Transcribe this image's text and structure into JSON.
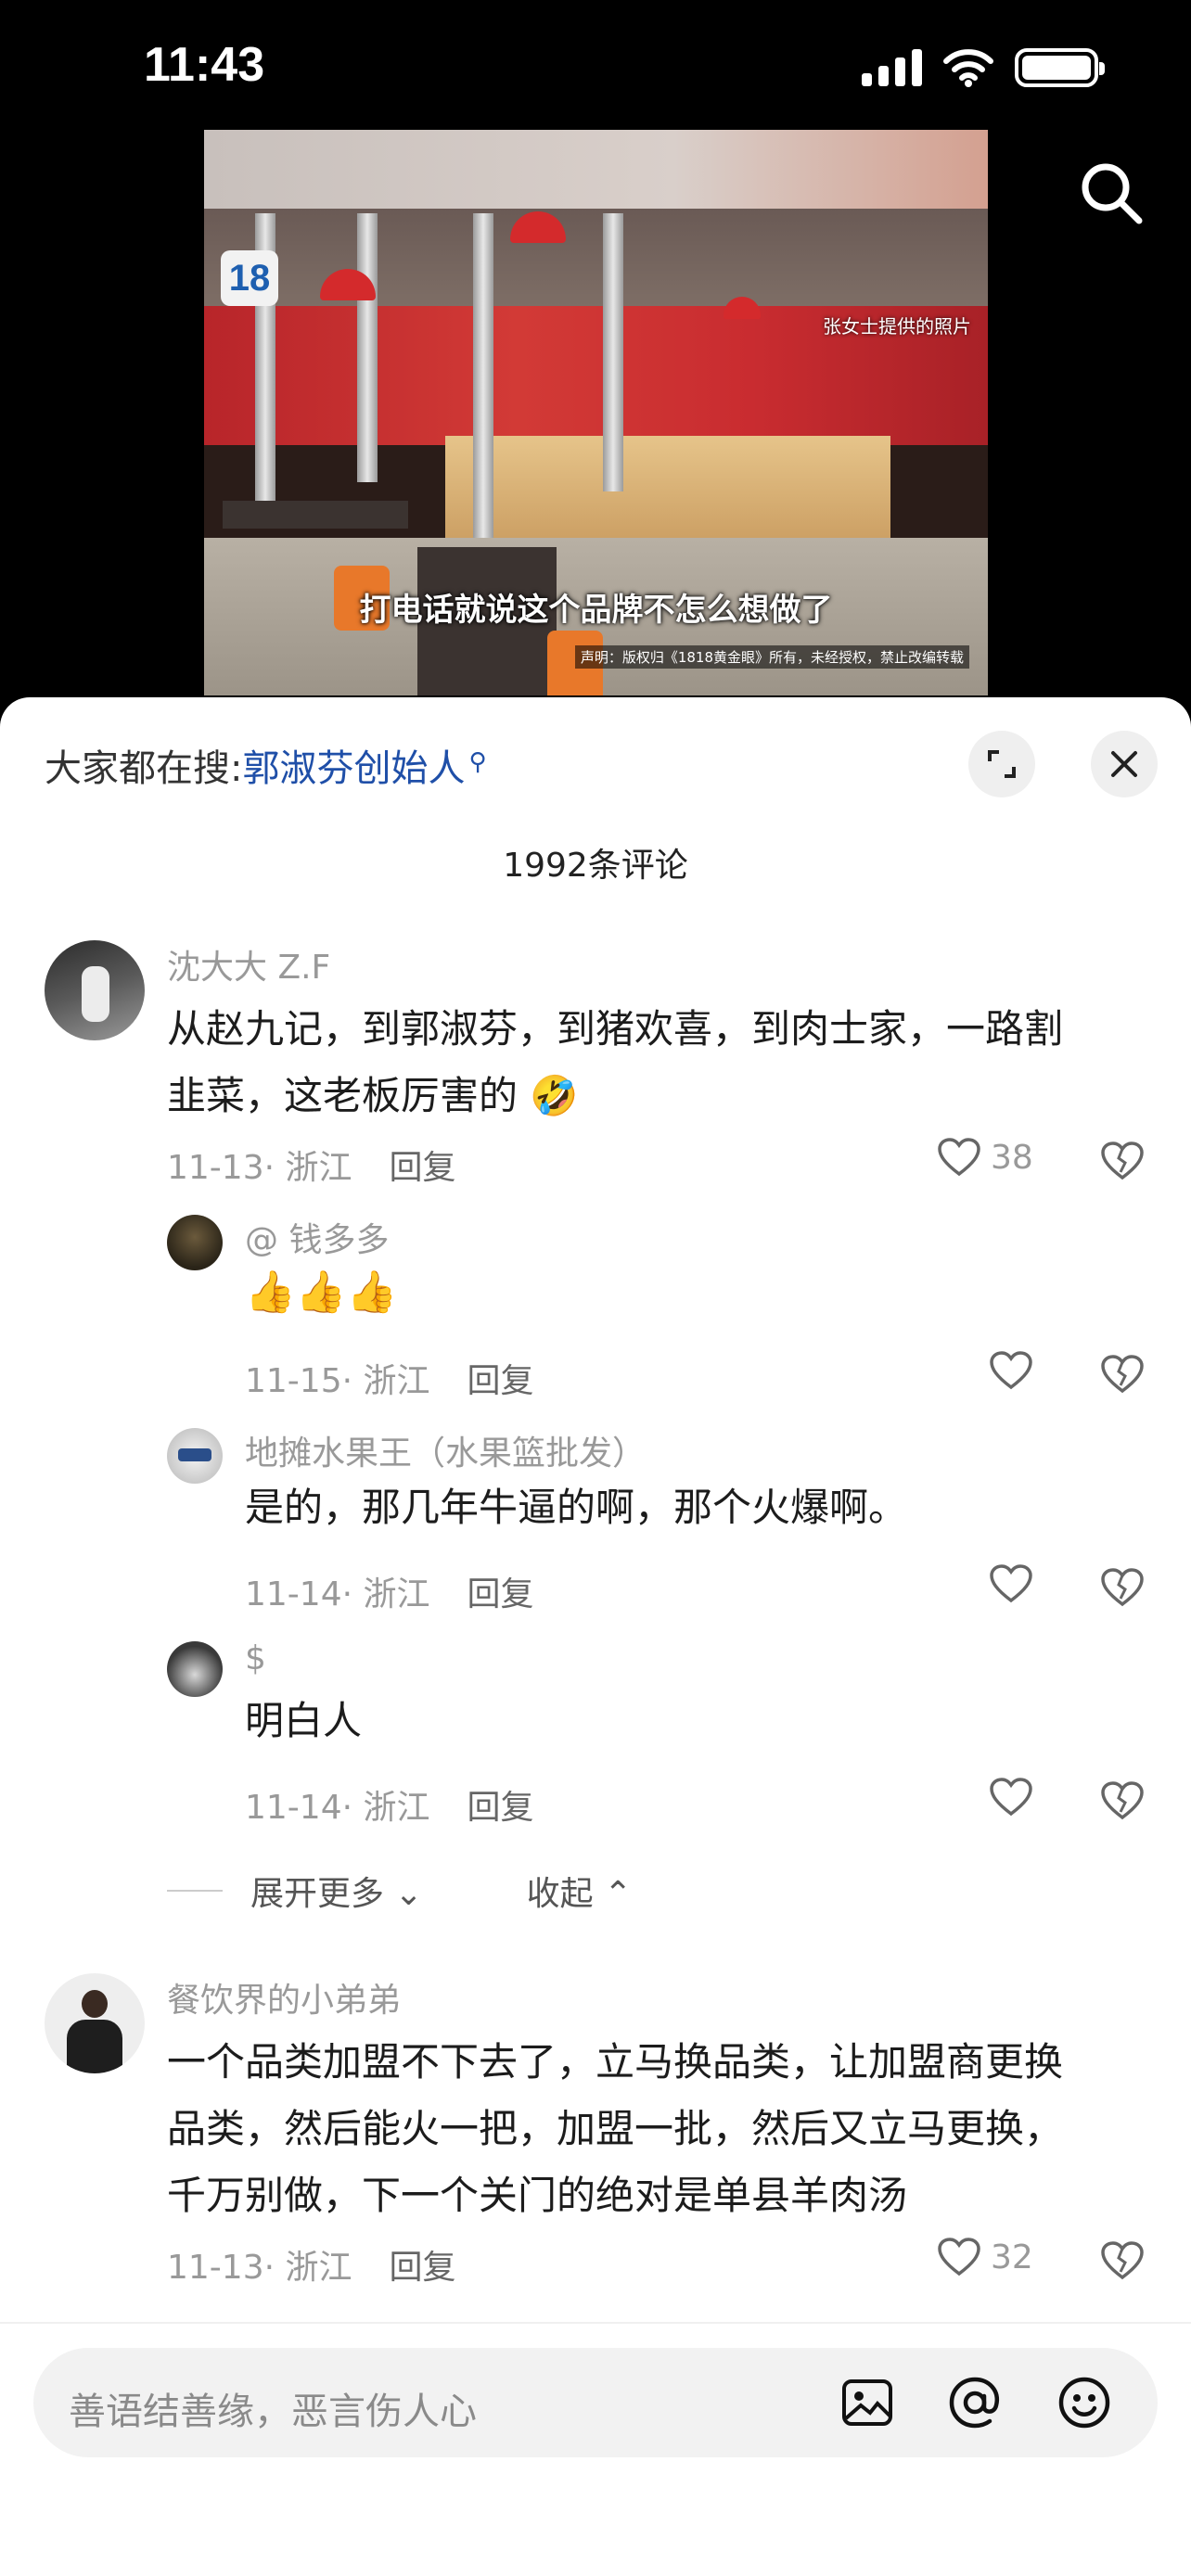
{
  "status_bar": {
    "time": "11:43"
  },
  "video": {
    "channel_logo": "18",
    "photo_credit": "张女士提供的照片",
    "subtitle": "打电话就说这个品牌不怎么想做了",
    "notice": "声明：版权归《1818黄金眼》所有，未经授权，禁止改编转载"
  },
  "sheet": {
    "search_prefix": "大家都在搜:",
    "search_keyword": "郭淑芬创始人",
    "comment_count": "1992条评论"
  },
  "comments": [
    {
      "user": "沈大大 Z.F",
      "text_line1": "从赵九记，到郭淑芬，到猪欢喜，到肉士家，一路割",
      "text_line2": "韭菜，这老板厉害的",
      "emoji": "🤣",
      "date": "11-13",
      "location": "浙江",
      "reply_label": "回复",
      "likes": "38"
    },
    {
      "user": "@ 钱多多",
      "text": "👍👍👍",
      "date": "11-15",
      "location": "浙江",
      "reply_label": "回复",
      "likes": ""
    },
    {
      "user": "地摊水果王（水果篮批发）",
      "text": "是的，那几年牛逼的啊，那个火爆啊。",
      "date": "11-14",
      "location": "浙江",
      "reply_label": "回复",
      "likes": ""
    },
    {
      "user": "$",
      "text": "明白人",
      "date": "11-14",
      "location": "浙江",
      "reply_label": "回复",
      "likes": ""
    },
    {
      "user": "餐饮界的小弟弟",
      "text_line1": "一个品类加盟不下去了，立马换品类，让加盟商更换",
      "text_line2": "品类，然后能火一把，加盟一批，然后又立马更换，",
      "text_line3": "千万别做，下一个关门的绝对是单县羊肉汤",
      "date": "11-13",
      "location": "浙江",
      "reply_label": "回复",
      "likes": "32"
    }
  ],
  "thread_controls": {
    "expand_more": "展开更多",
    "collapse": "收起"
  },
  "input": {
    "placeholder": "善语结善缘，恶言伤人心"
  },
  "icons": {
    "search": "search-icon",
    "expand": "expand-icon",
    "close": "close-icon",
    "like": "heart-icon",
    "dislike": "broken-heart-icon",
    "image": "image-icon",
    "mention": "at-icon",
    "emoji": "smiley-icon"
  },
  "colors": {
    "keyword": "#1f4fa8",
    "meta": "#999999",
    "text": "#1c1c1c"
  }
}
